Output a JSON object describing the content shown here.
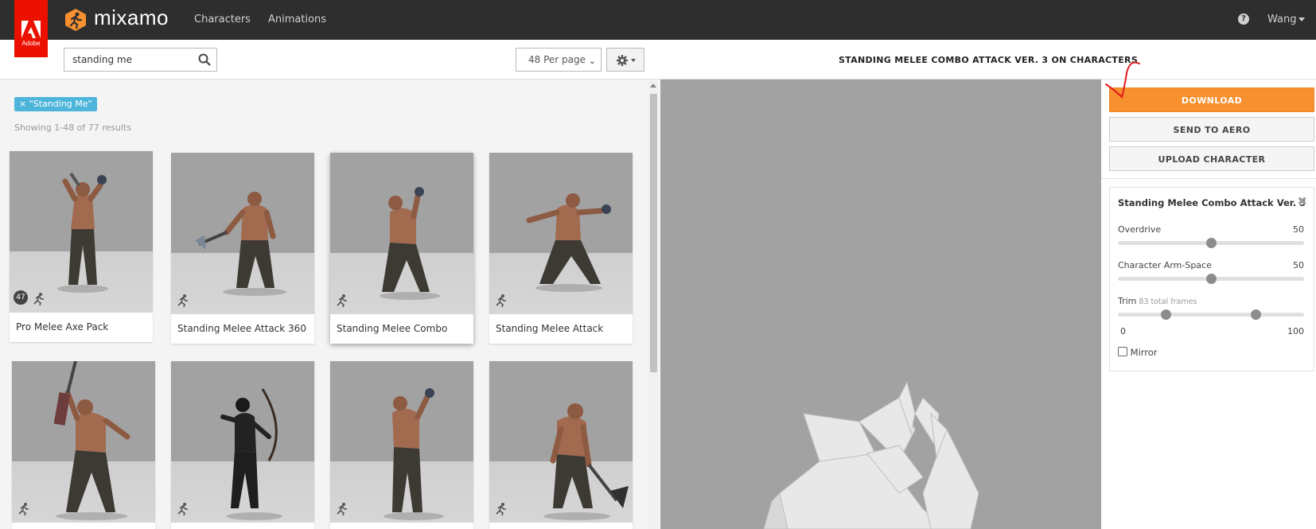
{
  "header": {
    "adobe_label": "Adobe",
    "app_name": "mixamo",
    "nav": [
      "Characters",
      "Animations"
    ],
    "user": "Wang",
    "help_glyph": "?"
  },
  "toolbar": {
    "search_value": "standing me",
    "per_page": "48 Per page",
    "per_page_caret": "⌄"
  },
  "filters": {
    "tag": "× \"Standing Me\"",
    "result_count": "Showing 1-48 of 77 results"
  },
  "cards": [
    {
      "caption": "Pro Melee Axe Pack",
      "count": "47"
    },
    {
      "caption": "Standing Melee Attack 360"
    },
    {
      "caption": "Standing Melee Combo"
    },
    {
      "caption": "Standing Melee Attack"
    },
    {
      "caption": ""
    },
    {
      "caption": ""
    },
    {
      "caption": ""
    },
    {
      "caption": ""
    }
  ],
  "viewer": {
    "title": "STANDING MELEE COMBO ATTACK VER. 3 ON CHARACTERS"
  },
  "sidebar": {
    "download": "DOWNLOAD",
    "send_to_aero": "SEND TO AERO",
    "upload_character": "UPLOAD CHARACTER",
    "panel_title": "Standing Melee Combo Attack Ver. 3",
    "close_glyph": "✖",
    "overdrive_label": "Overdrive",
    "overdrive_value": "50",
    "overdrive_level": 0.5,
    "arm_label": "Character Arm-Space",
    "arm_value": "50",
    "arm_level": 0.5,
    "trim_label": "Trim",
    "trim_sub": "83 total frames",
    "trim_min": "0",
    "trim_max": "100",
    "trim_start_level": 0.26,
    "trim_end_level": 0.74,
    "mirror_label": "Mirror"
  },
  "colors": {
    "accent": "#f7902e",
    "tag": "#4eb5da",
    "adobe_red": "#eb1000",
    "topbar": "#2e2e2e"
  }
}
